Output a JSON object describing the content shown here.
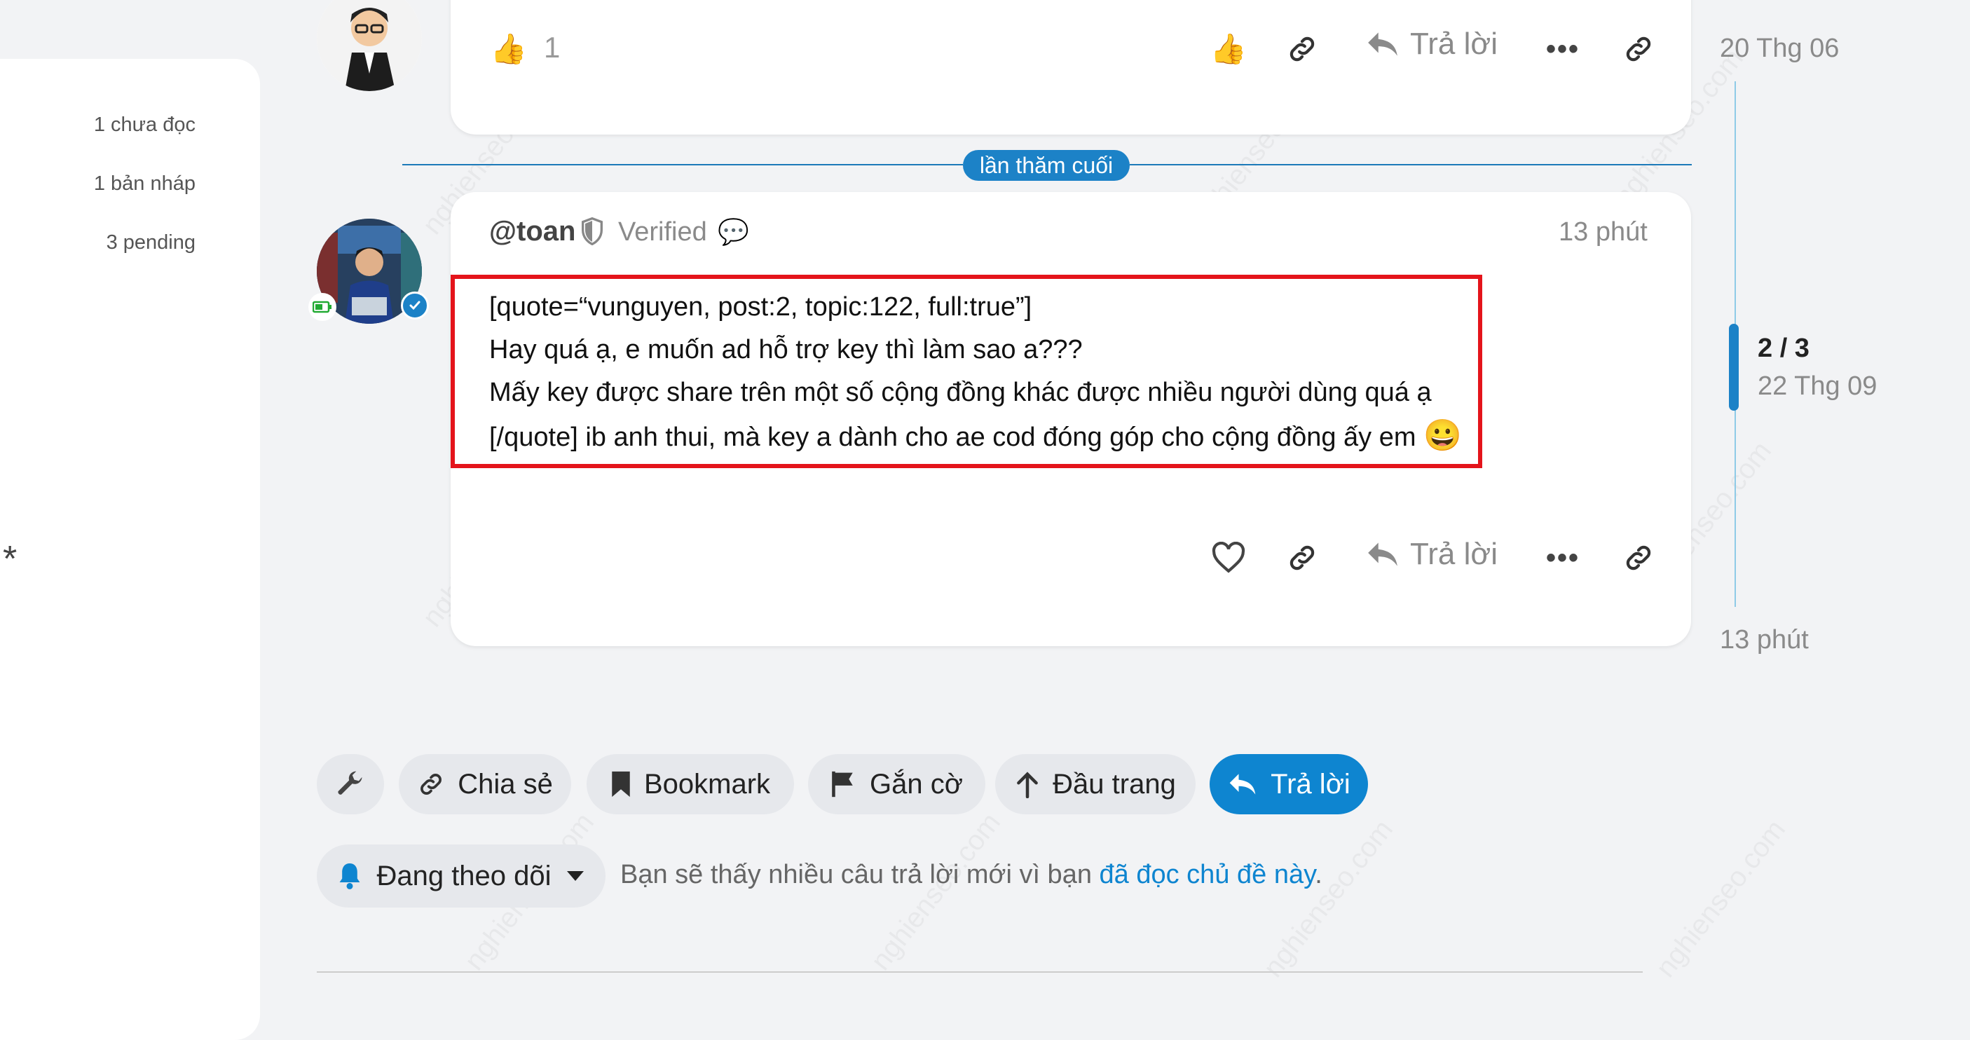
{
  "sidebar": {
    "items": [
      {
        "label": "1 chưa đọc"
      },
      {
        "label": "1 bản nháp"
      },
      {
        "label": "3 pending"
      }
    ],
    "marker": "*"
  },
  "post1": {
    "like_count": "1",
    "reply_label": "Trả lời",
    "date": "20 Thg 06"
  },
  "last_visit_label": "lần thăm cuối",
  "post2": {
    "username": "@toan",
    "user_title": "Verified",
    "time": "13 phút",
    "body": [
      "[quote=“vunguyen, post:2, topic:122, full:true”]",
      "Hay quá ạ, e muốn ad hỗ trợ key thì làm sao a???",
      "Mấy key được share trên một số cộng đồng khác được nhiều người dùng quá ạ",
      "[/quote] ib anh thui, mà key a dành cho ae cod đóng góp cho cộng đồng ấy em"
    ],
    "emoji": "😀",
    "reply_label": "Trả lời"
  },
  "timeline": {
    "position": "2 / 3",
    "date": "22 Thg 09",
    "end_time": "13 phút"
  },
  "footer": {
    "share": "Chia sẻ",
    "bookmark": "Bookmark",
    "flag": "Gắn cờ",
    "top": "Đầu trang",
    "reply": "Trả lời",
    "tracking": "Đang theo dõi",
    "notice_prefix": "Bạn sẽ thấy nhiều câu trả lời mới vì bạn ",
    "notice_link": "đã đọc chủ đề này",
    "notice_suffix": "."
  },
  "watermark_text": "nghienseo.com",
  "colors": {
    "accent": "#0e85d0",
    "highlight_border": "#e4141b",
    "background": "#f2f3f5"
  }
}
